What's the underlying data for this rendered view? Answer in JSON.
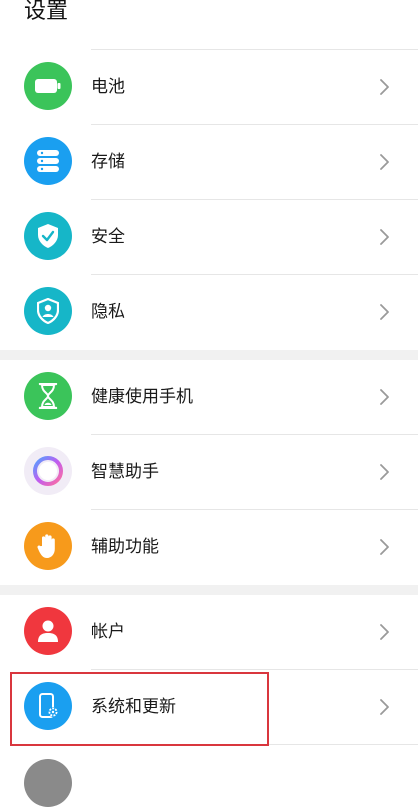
{
  "header": {
    "title": "设置"
  },
  "groups": [
    {
      "items": [
        {
          "label": "电池",
          "icon": "battery-icon",
          "color": "#3bc45a"
        },
        {
          "label": "存储",
          "icon": "storage-icon",
          "color": "#1a9ff0"
        },
        {
          "label": "安全",
          "icon": "security-shield-icon",
          "color": "#16b6c8"
        },
        {
          "label": "隐私",
          "icon": "privacy-icon",
          "color": "#16b6c8"
        }
      ]
    },
    {
      "items": [
        {
          "label": "健康使用手机",
          "icon": "hourglass-icon",
          "color": "#3bc45a"
        },
        {
          "label": "智慧助手",
          "icon": "assistant-orb-icon",
          "color": "#f1ecf6"
        },
        {
          "label": "辅助功能",
          "icon": "hand-icon",
          "color": "#f79a1b"
        }
      ]
    },
    {
      "items": [
        {
          "label": "帐户",
          "icon": "account-icon",
          "color": "#f0373e"
        },
        {
          "label": "系统和更新",
          "icon": "system-update-icon",
          "color": "#1a9ff0"
        }
      ]
    }
  ],
  "highlight_color": "#d9363e"
}
